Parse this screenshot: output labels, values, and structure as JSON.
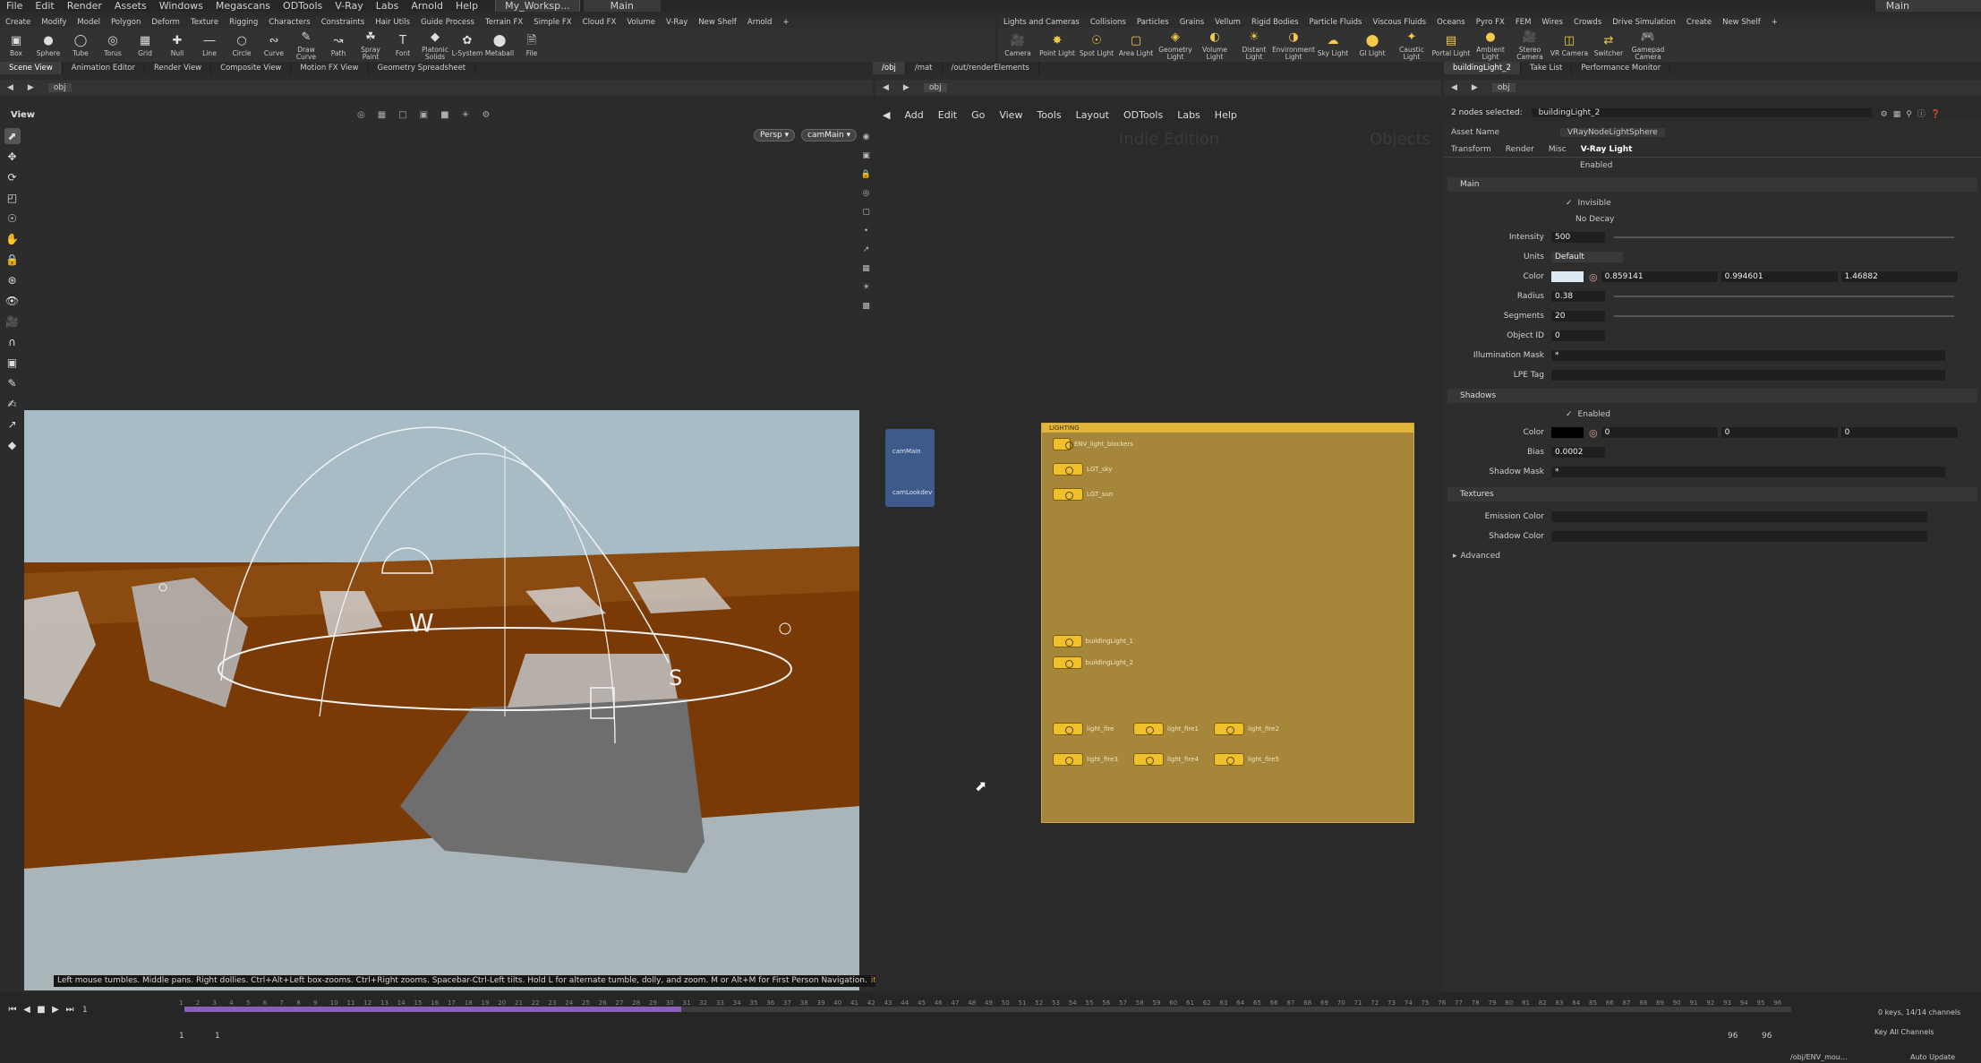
{
  "menubar": {
    "items": [
      "File",
      "Edit",
      "Render",
      "Assets",
      "Windows",
      "Megascans",
      "ODTools",
      "V-Ray",
      "Labs",
      "Arnold",
      "Help"
    ],
    "workspace": "My_Worksp...",
    "desktop": "Main",
    "right_desktop": "Main"
  },
  "shelf_left_tabs": [
    "Create",
    "Modify",
    "Model",
    "Polygon",
    "Deform",
    "Texture",
    "Rigging",
    "Characters",
    "Constraints",
    "Hair Utils",
    "Guide Process",
    "Terrain FX",
    "Simple FX",
    "Cloud FX",
    "Volume",
    "V-Ray",
    "New Shelf",
    "Arnold",
    "+"
  ],
  "shelf_left_tools": [
    {
      "label": "Box",
      "icon": "box-icon"
    },
    {
      "label": "Sphere",
      "icon": "sphere-icon"
    },
    {
      "label": "Tube",
      "icon": "tube-icon"
    },
    {
      "label": "Torus",
      "icon": "torus-icon"
    },
    {
      "label": "Grid",
      "icon": "grid-icon"
    },
    {
      "label": "Null",
      "icon": "null-icon"
    },
    {
      "label": "Line",
      "icon": "line-icon"
    },
    {
      "label": "Circle",
      "icon": "circle-icon"
    },
    {
      "label": "Curve",
      "icon": "curve-icon"
    },
    {
      "label": "Draw Curve",
      "icon": "draw-curve-icon"
    },
    {
      "label": "Path",
      "icon": "path-icon"
    },
    {
      "label": "Spray Paint",
      "icon": "spray-paint-icon"
    },
    {
      "label": "Font",
      "icon": "font-icon"
    },
    {
      "label": "Platonic Solids",
      "icon": "platonic-icon"
    },
    {
      "label": "L-System",
      "icon": "lsystem-icon"
    },
    {
      "label": "Metaball",
      "icon": "metaball-icon"
    },
    {
      "label": "File",
      "icon": "file-icon"
    }
  ],
  "shelf_right_tabs": [
    "Lights and Cameras",
    "Collisions",
    "Particles",
    "Grains",
    "Vellum",
    "Rigid Bodies",
    "Particle Fluids",
    "Viscous Fluids",
    "Oceans",
    "Pyro FX",
    "FEM",
    "Wires",
    "Crowds",
    "Drive Simulation",
    "Create",
    "New Shelf",
    "+"
  ],
  "shelf_right_tools": [
    "Camera",
    "Point Light",
    "Spot Light",
    "Area Light",
    "Geometry Light",
    "Volume Light",
    "Distant Light",
    "Environment Light",
    "Sky Light",
    "GI Light",
    "Caustic Light",
    "Portal Light",
    "Ambient Light",
    "Stereo Camera",
    "VR Camera",
    "Switcher",
    "Gamepad Camera"
  ],
  "pane_tabs_left": [
    "Scene View",
    "Animation Editor",
    "Render View",
    "Composite View",
    "Motion FX View",
    "Geometry Spreadsheet"
  ],
  "pane_tabs_mid": [
    "/obj",
    "/mat",
    "/out/renderElements"
  ],
  "pane_tabs_right": [
    "buildingLight_2",
    "Take List",
    "Performance Monitor"
  ],
  "path_left": "obj",
  "path_mid": "obj",
  "path_right": "obj",
  "viewport": {
    "title": "View",
    "persp": "Persp ▾",
    "camera": "camMain ▾",
    "status_text": "Left mouse tumbles. Middle pans. Right dollies. Ctrl+Alt+Left box-zooms. Ctrl+Right zooms. Spacebar-Ctrl-Left tilts. Hold L for alternate tumble, dolly, and zoom.    M or Alt+M for First Person Navigation.",
    "status_tail": "ition"
  },
  "network": {
    "menu": [
      "Add",
      "Edit",
      "Go",
      "View",
      "Tools",
      "Layout",
      "ODTools",
      "Labs",
      "Help"
    ],
    "watermark_left": "Indie Edition",
    "watermark_right": "Objects",
    "box_title": "LIGHTING",
    "cam_nodes": [
      "camMain",
      "camLookdev"
    ],
    "nodes": [
      {
        "name": "ENV_light_blockers"
      },
      {
        "name": "LGT_sky"
      },
      {
        "name": "LGT_sun"
      },
      {
        "name": "buildingLight_1"
      },
      {
        "name": "buildingLight_2"
      },
      {
        "name": "light_fire"
      },
      {
        "name": "light_fire1"
      },
      {
        "name": "light_fire2"
      },
      {
        "name": "light_fire3"
      },
      {
        "name": "light_fire4"
      },
      {
        "name": "light_fire5"
      }
    ]
  },
  "params": {
    "selected_label": "2 nodes selected:",
    "selected_value": "buildingLight_2",
    "asset_name_label": "Asset Name",
    "asset_name": "VRayNodeLightSphere",
    "tabs": [
      "Transform",
      "Render",
      "Misc",
      "V-Ray Light"
    ],
    "enabled": "Enabled",
    "main_section": "Main",
    "invisible": "Invisible",
    "no_decay": "No Decay",
    "intensity_label": "Intensity",
    "intensity": "500",
    "units_label": "Units",
    "units": "Default",
    "color_label": "Color",
    "color_r": "0.859141",
    "color_g": "0.994601",
    "color_b": "1.46882",
    "radius_label": "Radius",
    "radius": "0.38",
    "segments_label": "Segments",
    "segments": "20",
    "objid_label": "Object ID",
    "objid": "0",
    "illum_label": "Illumination Mask",
    "illum": "*",
    "lpe_label": "LPE Tag",
    "shadows_section": "Shadows",
    "shadows_enabled": "Enabled",
    "shadow_color_label": "Color",
    "shadow_r": "0",
    "shadow_g": "0",
    "shadow_b": "0",
    "bias_label": "Bias",
    "bias": "0.0002",
    "shadow_mask_label": "Shadow Mask",
    "shadow_mask": "*",
    "textures_section": "Textures",
    "emission_label": "Emission Color",
    "shadow_tex_label": "Shadow Color",
    "advanced_section": "Advanced"
  },
  "timeline": {
    "frame": "1",
    "start": "1",
    "start2": "1",
    "end": "96",
    "end2": "96",
    "keys": "0 keys, 14/14 channels",
    "key_all": "Key All Channels",
    "auto_update": "Auto Update",
    "path": "/obj/ENV_mou...",
    "ticks": [
      "1",
      "2",
      "3",
      "4",
      "5",
      "6",
      "7",
      "8",
      "9",
      "10",
      "11",
      "12",
      "13",
      "14",
      "15",
      "16",
      "17",
      "18",
      "19",
      "20",
      "21",
      "22",
      "23",
      "24",
      "25",
      "26",
      "27",
      "28",
      "29",
      "30",
      "31",
      "32",
      "33",
      "34",
      "35",
      "36",
      "37",
      "38",
      "39",
      "40",
      "41",
      "42",
      "43",
      "44",
      "45",
      "46",
      "47",
      "48",
      "49",
      "50",
      "51",
      "52",
      "53",
      "54",
      "55",
      "56",
      "57",
      "58",
      "59",
      "60",
      "61",
      "62",
      "63",
      "64",
      "65",
      "66",
      "67",
      "68",
      "69",
      "70",
      "71",
      "72",
      "73",
      "74",
      "75",
      "76",
      "77",
      "78",
      "79",
      "80",
      "81",
      "82",
      "83",
      "84",
      "85",
      "86",
      "87",
      "88",
      "89",
      "90",
      "91",
      "92",
      "93",
      "94",
      "95",
      "96"
    ]
  },
  "colors": {
    "network_box": "#a6863a",
    "node_light": "#f0c02a",
    "timeline_range": "#8b5fb8",
    "ground": "#7a3a06",
    "sky": "#a8bcc6"
  }
}
